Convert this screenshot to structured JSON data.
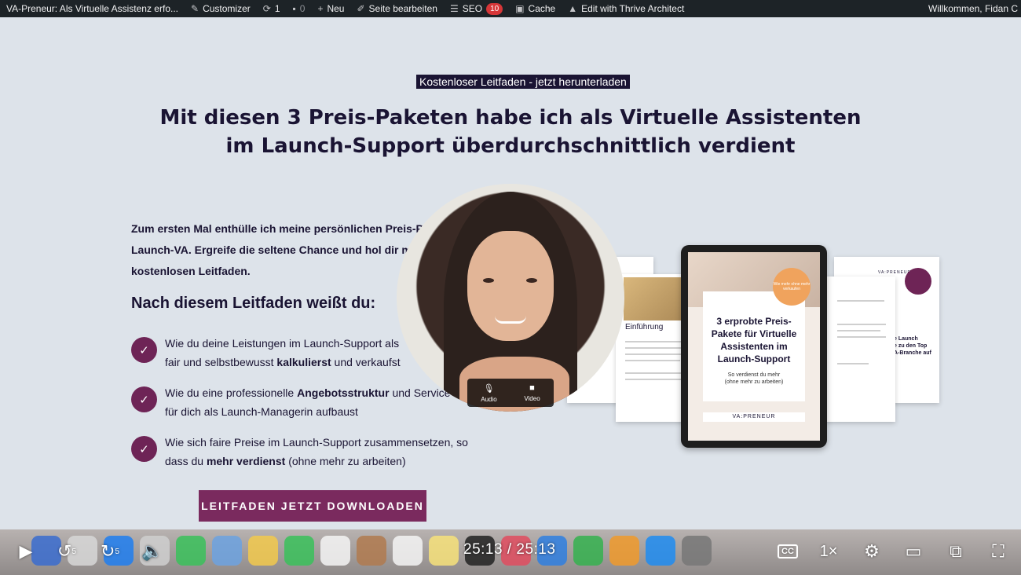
{
  "adminbar": {
    "site_title": "VA-Preneur: Als Virtuelle Assistenz erfo...",
    "customizer": "Customizer",
    "updates_count": "1",
    "comments_count": "0",
    "new_label": "Neu",
    "edit_page": "Seite bearbeiten",
    "seo_label": "SEO",
    "seo_badge": "10",
    "cache_label": "Cache",
    "thrive_label": "Edit with Thrive Architect",
    "greeting": "Willkommen, Fidan C"
  },
  "hero": {
    "kicker": "Kostenloser Leitfaden - jetzt herunterladen",
    "headline_line1": "Mit diesen 3 Preis-Paketen habe ich als Virtuelle Assistenten",
    "headline_line2": "im Launch-Support überdurchschnittlich verdient",
    "intro_line1": "Zum ersten Mal enthülle ich meine persönlichen Preis-P",
    "intro_line2": "Launch-VA. Ergreife die seltene Chance und hol dir m",
    "intro_line3": "kostenlosen Leitfaden.",
    "subhead": "Nach diesem Leitfaden weißt du:",
    "benefits": [
      {
        "pre": "Wie du deine Leistungen im Launch-Support als",
        "line2_pre": "fair und selbstbewusst ",
        "bold": "kalkulierst",
        "post": " und verkaufst"
      },
      {
        "pre": "Wie du eine professionelle ",
        "bold": "Angebotsstruktur",
        "post": " und Service",
        "line2": "für dich als Launch-Managerin aufbaust"
      },
      {
        "pre": "Wie sich faire Preise im Launch-Support zusammensetzen, so",
        "line2_pre": "dass du ",
        "bold": "mehr verdienst",
        "post": " (ohne mehr zu arbeiten)"
      }
    ],
    "cta": "LEITFADEN JETZT DOWNLOADEN"
  },
  "mockup": {
    "tablet_title": "3 erprobte Preis-Pakete für Virtuelle Assistenten im Launch-Support",
    "tablet_sub_line1": "So verdienst du mehr",
    "tablet_sub_line2": "(ohne mehr zu arbeiten)",
    "seal_text": "Wie mehr ohne mehr verkaufen",
    "brand": "VA:PRENEUR",
    "doc_heading": "Einführung",
    "doc_right_line1": "e Launch",
    "doc_right_line2": "e zu den Top",
    "doc_right_line3": "A-Branche auf",
    "doc_right_brand": "VA:PRENEUR"
  },
  "webcam": {
    "audio_label": "Audio",
    "video_label": "Video"
  },
  "player": {
    "time": "25:13 / 25:13",
    "rewind_seconds": "5",
    "forward_seconds": "5",
    "speed": "1×",
    "cc": "CC"
  },
  "icons": {
    "customizer": "brush-icon",
    "updates": "refresh-icon",
    "comments": "comment-icon",
    "new": "plus-icon",
    "edit": "pencil-icon",
    "seo": "seo-icon",
    "cache": "cache-icon",
    "thrive": "thrive-icon"
  },
  "colors": {
    "accent": "#7a2a5e",
    "navy": "#1a1433",
    "background": "#dde3ea",
    "adminbar": "#1d2327"
  }
}
